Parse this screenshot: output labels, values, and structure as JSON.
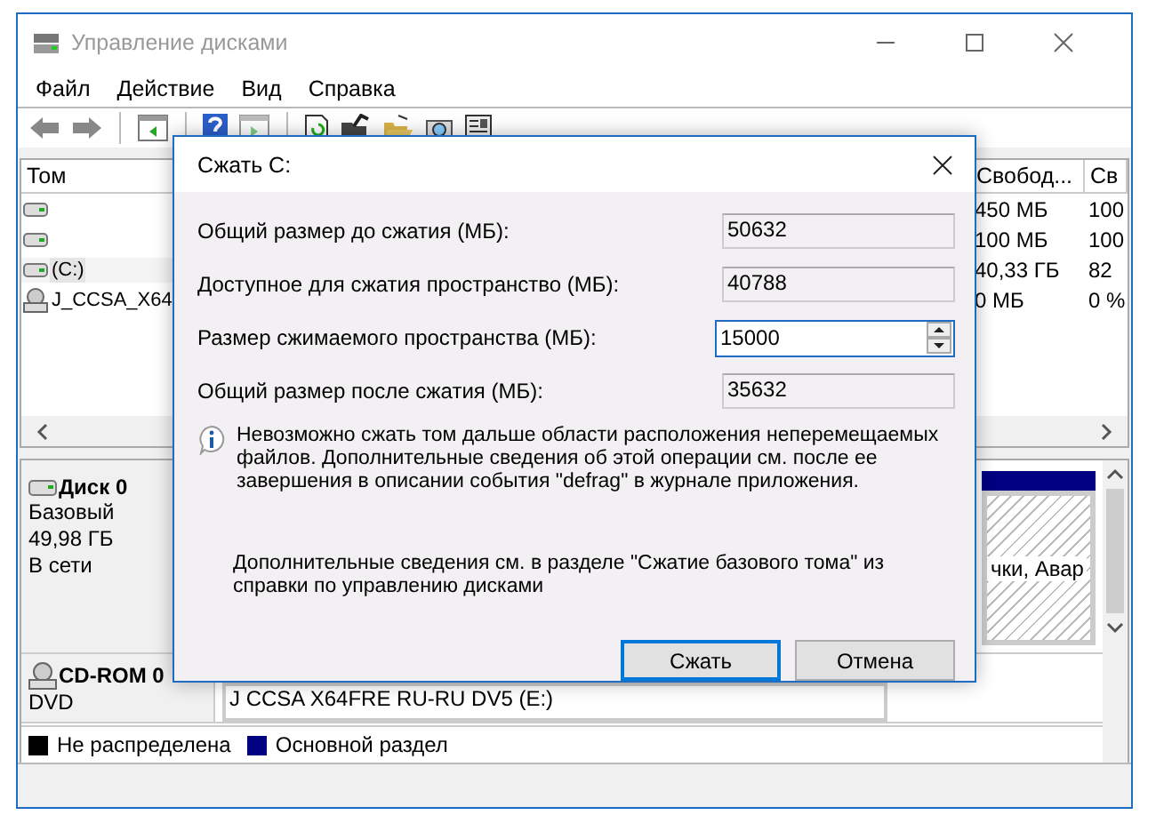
{
  "window": {
    "title": "Управление дисками"
  },
  "menu": [
    "Файл",
    "Действие",
    "Вид",
    "Справка"
  ],
  "volumes": {
    "columns": [
      "Том",
      "Свобод...",
      "Св"
    ],
    "rows": [
      {
        "name": "",
        "kind": "disk",
        "free": "450 МБ",
        "percent": "100",
        "selected": false
      },
      {
        "name": "",
        "kind": "disk",
        "free": "100 МБ",
        "percent": "100",
        "selected": false
      },
      {
        "name": "(C:)",
        "kind": "disk",
        "free": "40,33 ГБ",
        "percent": "82",
        "selected": true
      },
      {
        "name": "J_CCSA_X64",
        "kind": "cdrom",
        "free": "0 МБ",
        "percent": "0 %",
        "selected": false
      }
    ]
  },
  "disks": [
    {
      "kind": "disk",
      "name": "Диск 0",
      "lines": [
        "Базовый",
        "49,98 ГБ",
        "В сети"
      ],
      "partition": {
        "text": "чки, Авар",
        "selected": true
      }
    },
    {
      "kind": "cdrom",
      "name": "CD-ROM 0",
      "lines": [
        "DVD"
      ],
      "partition": {
        "text": "J CCSA X64FRE RU-RU DV5 (E:)",
        "selected": false
      }
    }
  ],
  "legend": [
    {
      "label": "Не распределена",
      "color": "#000000"
    },
    {
      "label": "Основной раздел",
      "color": "#000080"
    }
  ],
  "dialog": {
    "title": "Сжать C:",
    "fields": [
      {
        "label": "Общий размер до сжатия (МБ):",
        "value": "50632",
        "kind": "readonly"
      },
      {
        "label": "Доступное для сжатия пространство (МБ):",
        "value": "40788",
        "kind": "readonly"
      },
      {
        "label": "Размер сжимаемого пространства (МБ):",
        "value": "15000",
        "kind": "spin"
      },
      {
        "label": "Общий размер после сжатия (МБ):",
        "value": "35632",
        "kind": "readonly"
      }
    ],
    "info": "Невозможно сжать том дальше области расположения неперемещаемых файлов. Дополнительные сведения об этой операции см. после ее завершения в описании события \"defrag\" в журнале приложения.",
    "note": "Дополнительные сведения см. в разделе \"Сжатие базового тома\" из справки по управлению дисками",
    "buttons": [
      {
        "label": "Сжать",
        "default": true
      },
      {
        "label": "Отмена",
        "default": false
      }
    ]
  }
}
